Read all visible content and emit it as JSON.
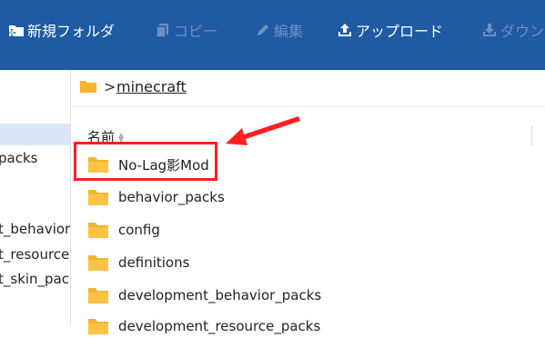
{
  "toolbar": {
    "items": [
      {
        "label": "新規フォルダ",
        "icon": "new-folder-icon",
        "enabled": true
      },
      {
        "label": "コピー",
        "icon": "copy-icon",
        "enabled": false
      },
      {
        "label": "編集",
        "icon": "pencil-icon",
        "enabled": false
      },
      {
        "label": "アップロード",
        "icon": "upload-icon",
        "enabled": true
      },
      {
        "label": "ダウン",
        "icon": "download-icon",
        "enabled": false
      }
    ]
  },
  "sidebar": {
    "items": [
      {
        "label": "",
        "selected": true
      },
      {
        "label": "packs",
        "selected": false
      },
      {
        "label": "t_behavior",
        "selected": false
      },
      {
        "label": "t_resource",
        "selected": false
      },
      {
        "label": "t_skin_pac",
        "selected": false
      }
    ]
  },
  "breadcrumb": {
    "separator": ">",
    "current": "minecraft"
  },
  "list": {
    "column_header": "名前",
    "items": [
      {
        "name": "No-Lag影Mod"
      },
      {
        "name": "behavior_packs"
      },
      {
        "name": "config"
      },
      {
        "name": "definitions"
      },
      {
        "name": "development_behavior_packs"
      },
      {
        "name": "development_resource_packs"
      }
    ]
  },
  "colors": {
    "toolbar_bg": "#1f5aa3",
    "folder": "#f5b52e",
    "highlight": "#ff1f1f",
    "selection": "#d8e6f7"
  }
}
